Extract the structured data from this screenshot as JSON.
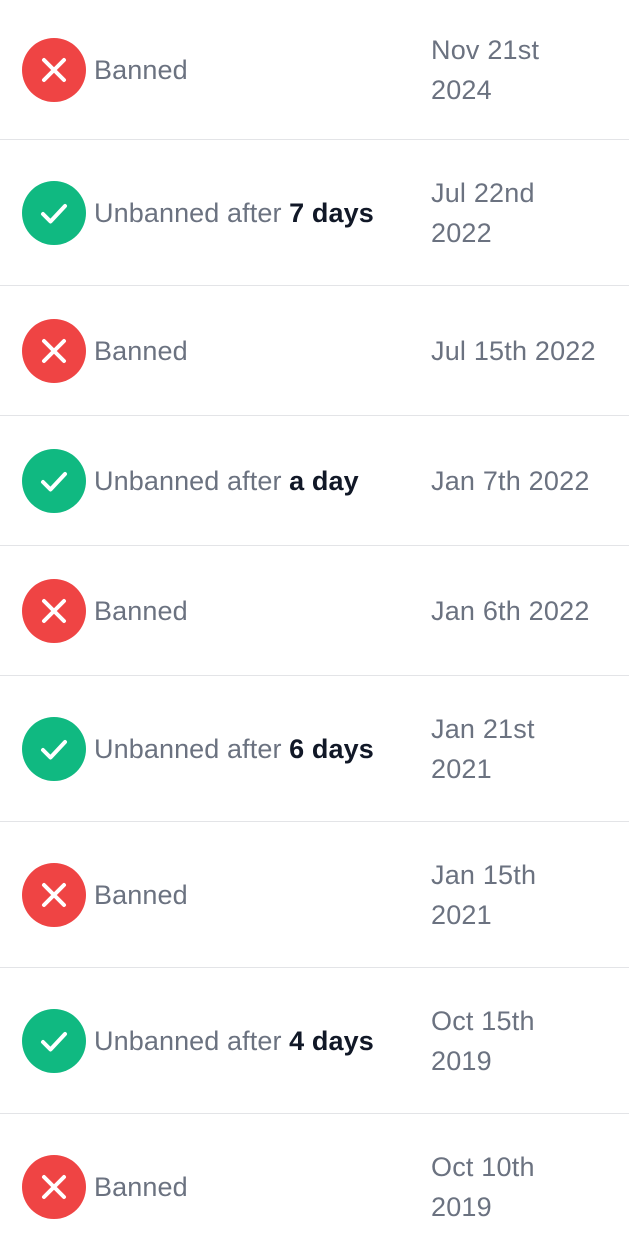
{
  "colors": {
    "banned": "#ef4444",
    "unbanned": "#10b981",
    "muted_text": "#6b7280",
    "strong_text": "#111827",
    "divider": "#e3e4e7"
  },
  "history": [
    {
      "status": "banned",
      "icon": "close-icon",
      "label": "Banned",
      "duration": "",
      "date": "Nov 21st 2024"
    },
    {
      "status": "unbanned",
      "icon": "check-icon",
      "label": "Unbanned after",
      "duration": "7 days",
      "date": "Jul 22nd 2022"
    },
    {
      "status": "banned",
      "icon": "close-icon",
      "label": "Banned",
      "duration": "",
      "date": "Jul 15th 2022"
    },
    {
      "status": "unbanned",
      "icon": "check-icon",
      "label": "Unbanned after",
      "duration": "a day",
      "date": "Jan 7th 2022"
    },
    {
      "status": "banned",
      "icon": "close-icon",
      "label": "Banned",
      "duration": "",
      "date": "Jan 6th 2022"
    },
    {
      "status": "unbanned",
      "icon": "check-icon",
      "label": "Unbanned after",
      "duration": "6 days",
      "date": "Jan 21st 2021"
    },
    {
      "status": "banned",
      "icon": "close-icon",
      "label": "Banned",
      "duration": "",
      "date": "Jan 15th 2021"
    },
    {
      "status": "unbanned",
      "icon": "check-icon",
      "label": "Unbanned after",
      "duration": "4 days",
      "date": "Oct 15th 2019"
    },
    {
      "status": "banned",
      "icon": "close-icon",
      "label": "Banned",
      "duration": "",
      "date": "Oct 10th 2019"
    }
  ]
}
